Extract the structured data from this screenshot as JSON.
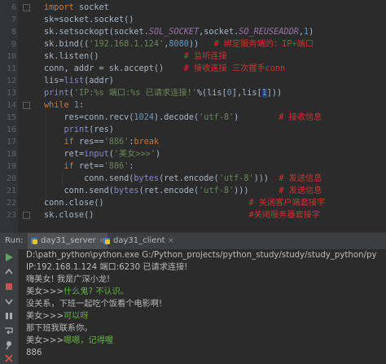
{
  "editor": {
    "line_numbers": [
      "6",
      "7",
      "8",
      "9",
      "10",
      "11",
      "12",
      "13",
      "14",
      "15",
      "16",
      "17",
      "18",
      "19",
      "20",
      "21",
      "22",
      "23"
    ],
    "lines": {
      "l6": {
        "kw": "import",
        "rest": " socket"
      },
      "l7": {
        "var": "sk",
        "eq": "=",
        "rest": "socket.socket()"
      },
      "l8": {
        "a": "sk.setsockopt(socket.",
        "c1": "SOL_SOCKET",
        "b": ",socket.",
        "c2": "SO_REUSEADDR",
        "c": ",",
        "n": "1",
        "d": ")"
      },
      "l9": {
        "a": "sk.bind((",
        "s": "'192.168.1.124'",
        "b": ",",
        "n": "8080",
        "c": "))",
        "cm": "# 绑定服务端的：IP+端口"
      },
      "l10": {
        "a": "sk.listen()",
        "cm": "# 监听连接"
      },
      "l11": {
        "a": "conn, addr = sk.accept()",
        "cm": "# 接收连接 三次握手conn"
      },
      "l12": {
        "a": "lis=",
        "bi": "list",
        "b": "(addr)"
      },
      "l13": {
        "bi": "print",
        "a": "(",
        "s": "'IP:%s 端口:%s 已请求连接!'",
        "b": "%(lis[",
        "n1": "0",
        "c": "],lis[",
        "n2": "1",
        "d": "]))"
      },
      "l14": {
        "kw": "while",
        "sp": " ",
        "n": "1",
        "b": ":"
      },
      "l15": {
        "a": "res=conn.recv(",
        "n": "1024",
        "b": ").decode(",
        "s": "'utf-8'",
        "c": ")",
        "cm": "# 接收信息"
      },
      "l16": {
        "bi": "print",
        "a": "(res)"
      },
      "l17": {
        "kw1": "if",
        "a": " res==",
        "s": "'886'",
        "b": ":",
        "kw2": "break"
      },
      "l18": {
        "a": "ret=",
        "bi": "input",
        "b": "(",
        "s": "'美女>>>'",
        "c": ")"
      },
      "l19": {
        "kw": "if",
        "a": " ret==",
        "s": "'886'",
        "b": ":"
      },
      "l20": {
        "a": "conn.send(",
        "bi": "bytes",
        "b": "(ret.encode(",
        "s": "'utf-8'",
        "c": ")))",
        "cm": "# 发送信息"
      },
      "l21": {
        "a": "conn.send(",
        "bi": "bytes",
        "b": "(ret.encode(",
        "s": "'utf-8'",
        "c": ")))",
        "cm": "# 发送信息"
      },
      "l22": {
        "a": "conn.close()",
        "cm": "# 关闭客户端套接字"
      },
      "l23": {
        "a": "sk.close()",
        "cm": "#关闭服务器套接字"
      }
    }
  },
  "run_panel": {
    "title": "Run:",
    "tabs": [
      {
        "label": "day31_server",
        "active": true
      },
      {
        "label": "day31_client",
        "active": false
      }
    ],
    "console_lines": [
      {
        "text": "D:\\path_python\\python.exe G:/Python_projects/python_study/study/study_python/py",
        "color": "default"
      },
      {
        "text": "IP:192.168.1.124 端口:6230 已请求连接!",
        "color": "default"
      },
      {
        "text": "嗨美女! 我是广深小龙!",
        "color": "default"
      },
      {
        "prompt": "美女>>>",
        "input": "什么鬼? 不认识。"
      },
      {
        "text": "没关系，下班一起吃个饭看个电影啊!",
        "color": "default"
      },
      {
        "prompt": "美女>>>",
        "input": "可以呀"
      },
      {
        "text": "那下班我联系你。",
        "color": "default"
      },
      {
        "prompt": "美女>>>",
        "input": "嗯嗯，记得喔"
      },
      {
        "text": "886",
        "color": "default"
      }
    ]
  },
  "colors": {
    "keyword": "#cc7832",
    "string": "#6a8759",
    "number": "#6897bb",
    "builtin": "#8888c6",
    "comment": "#cc3333",
    "console_input": "#62b543"
  }
}
